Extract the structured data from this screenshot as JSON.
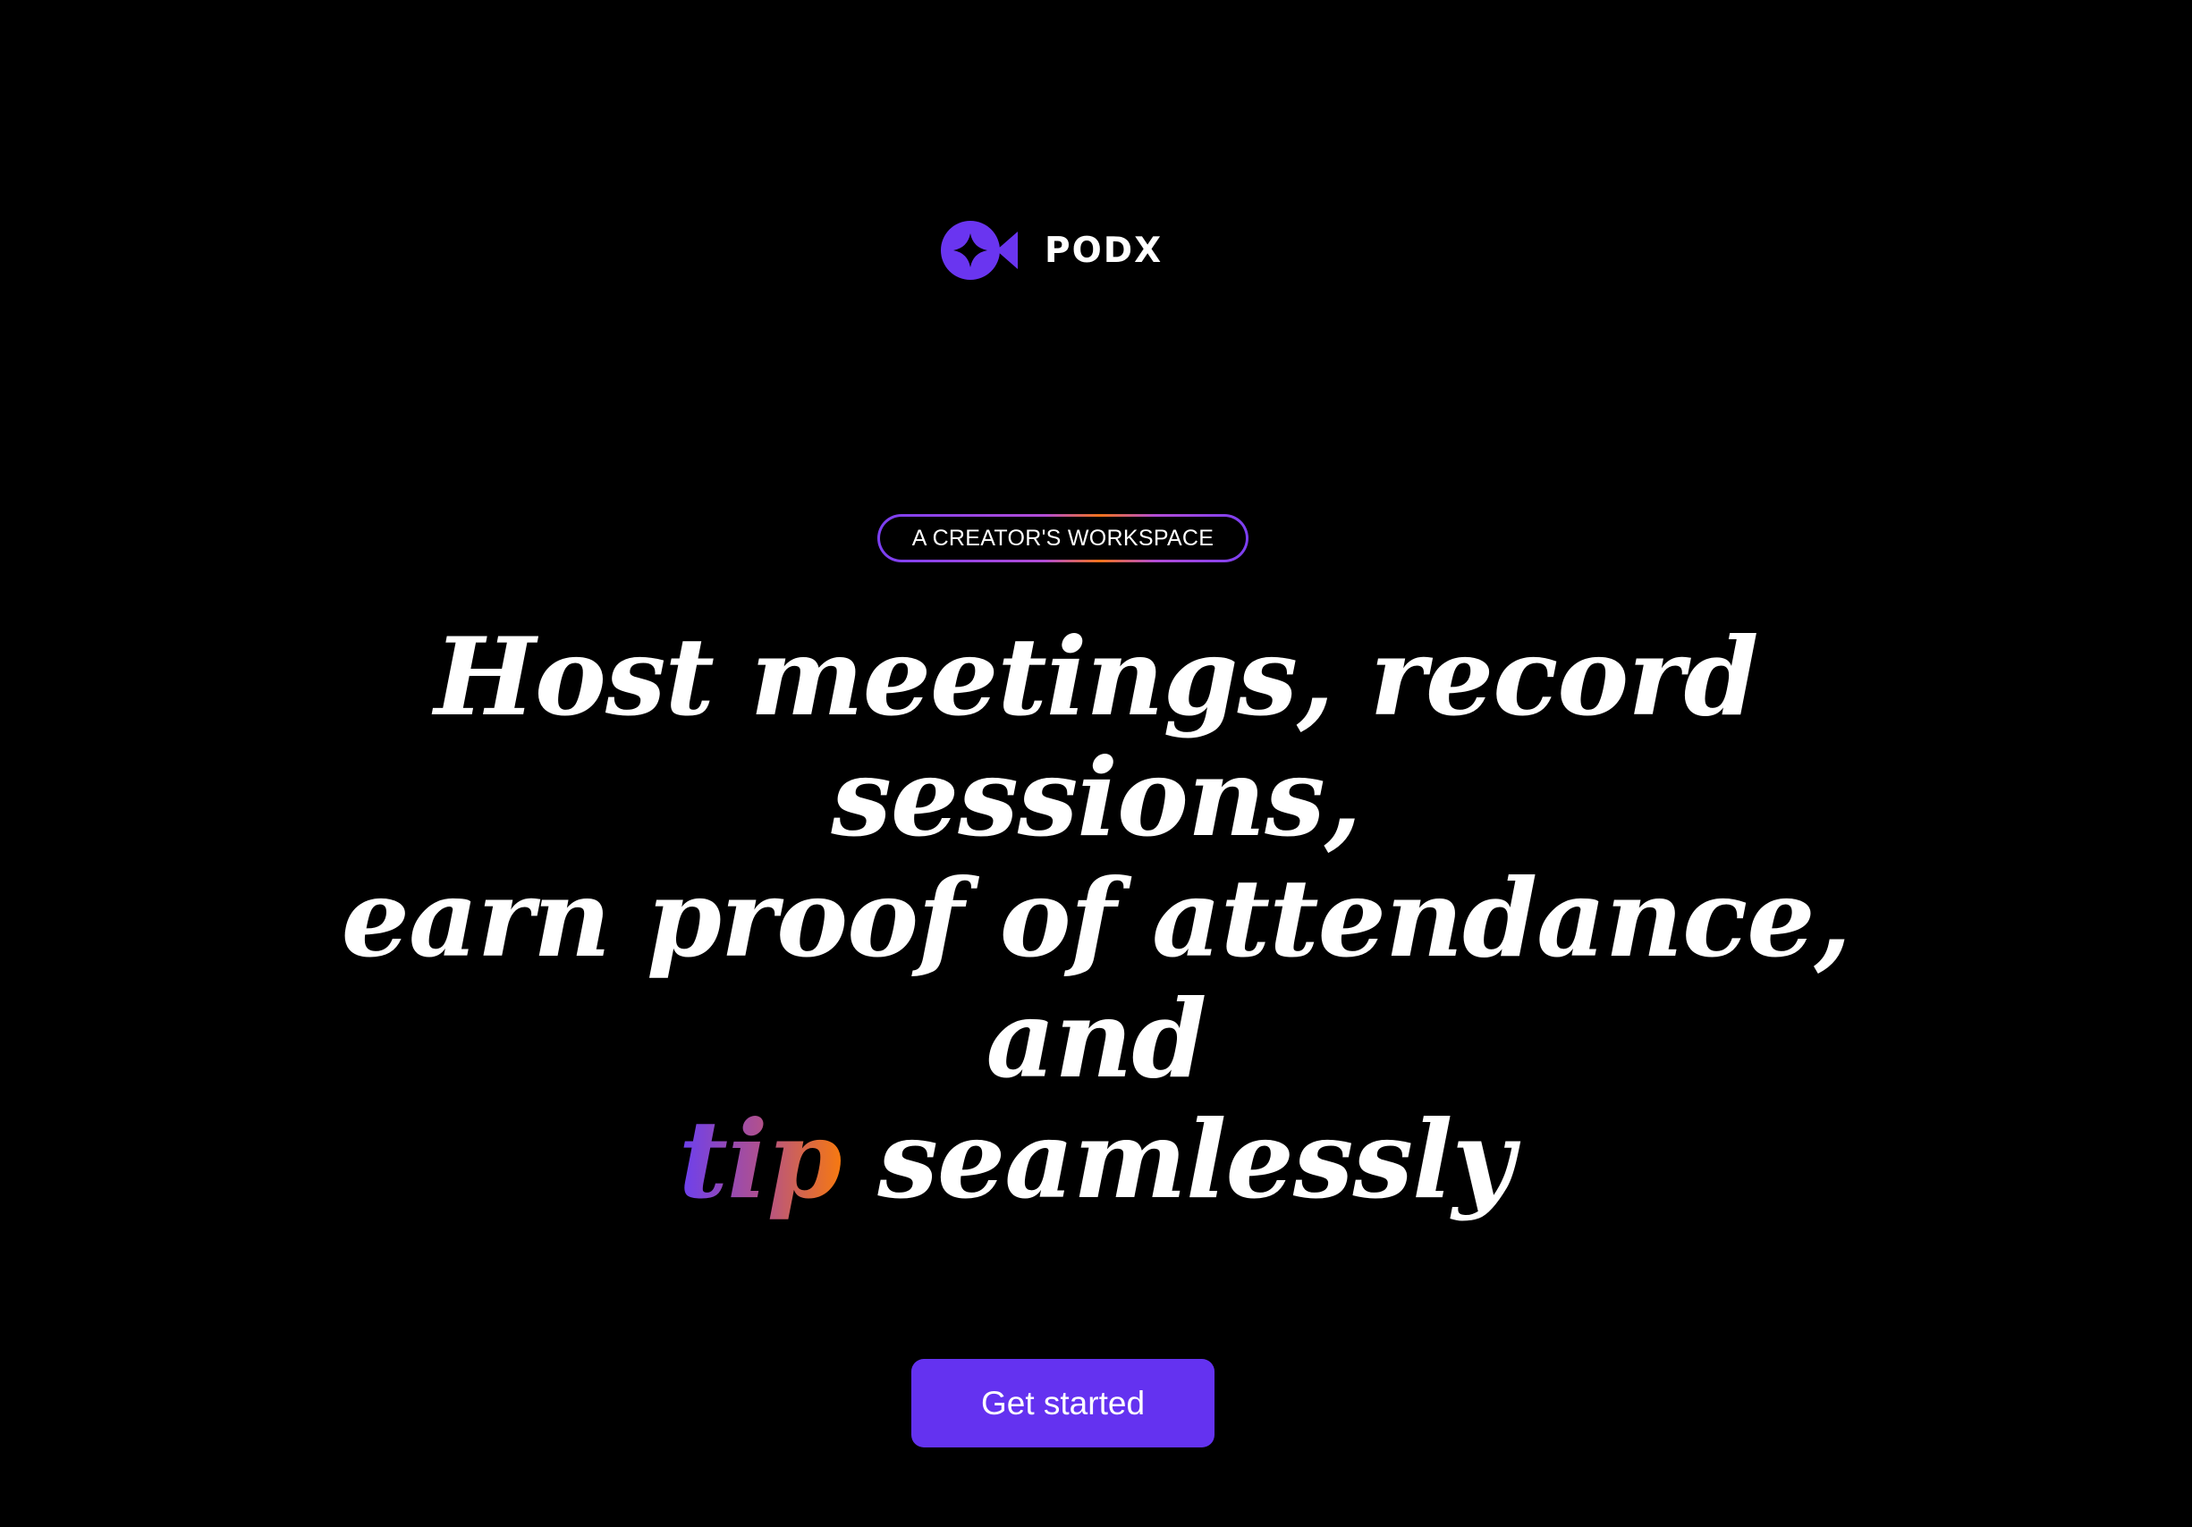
{
  "brand": {
    "name": "PODX",
    "icon": "video-camera-icon",
    "accent_color": "#6a35f0"
  },
  "hero": {
    "tag": "A CREATOR'S WORKSPACE",
    "headline": {
      "line1": "Host meetings, record",
      "line2": "sessions,",
      "line3": "earn proof of attendance,",
      "line4": "and",
      "line5_accent": "tip",
      "line5_rest": " seamlessly"
    },
    "accent_gradient": [
      "#6a3ff2",
      "#b0508e",
      "#f7790f"
    ]
  },
  "cta": {
    "label": "Get started",
    "color": "#6432f0"
  }
}
